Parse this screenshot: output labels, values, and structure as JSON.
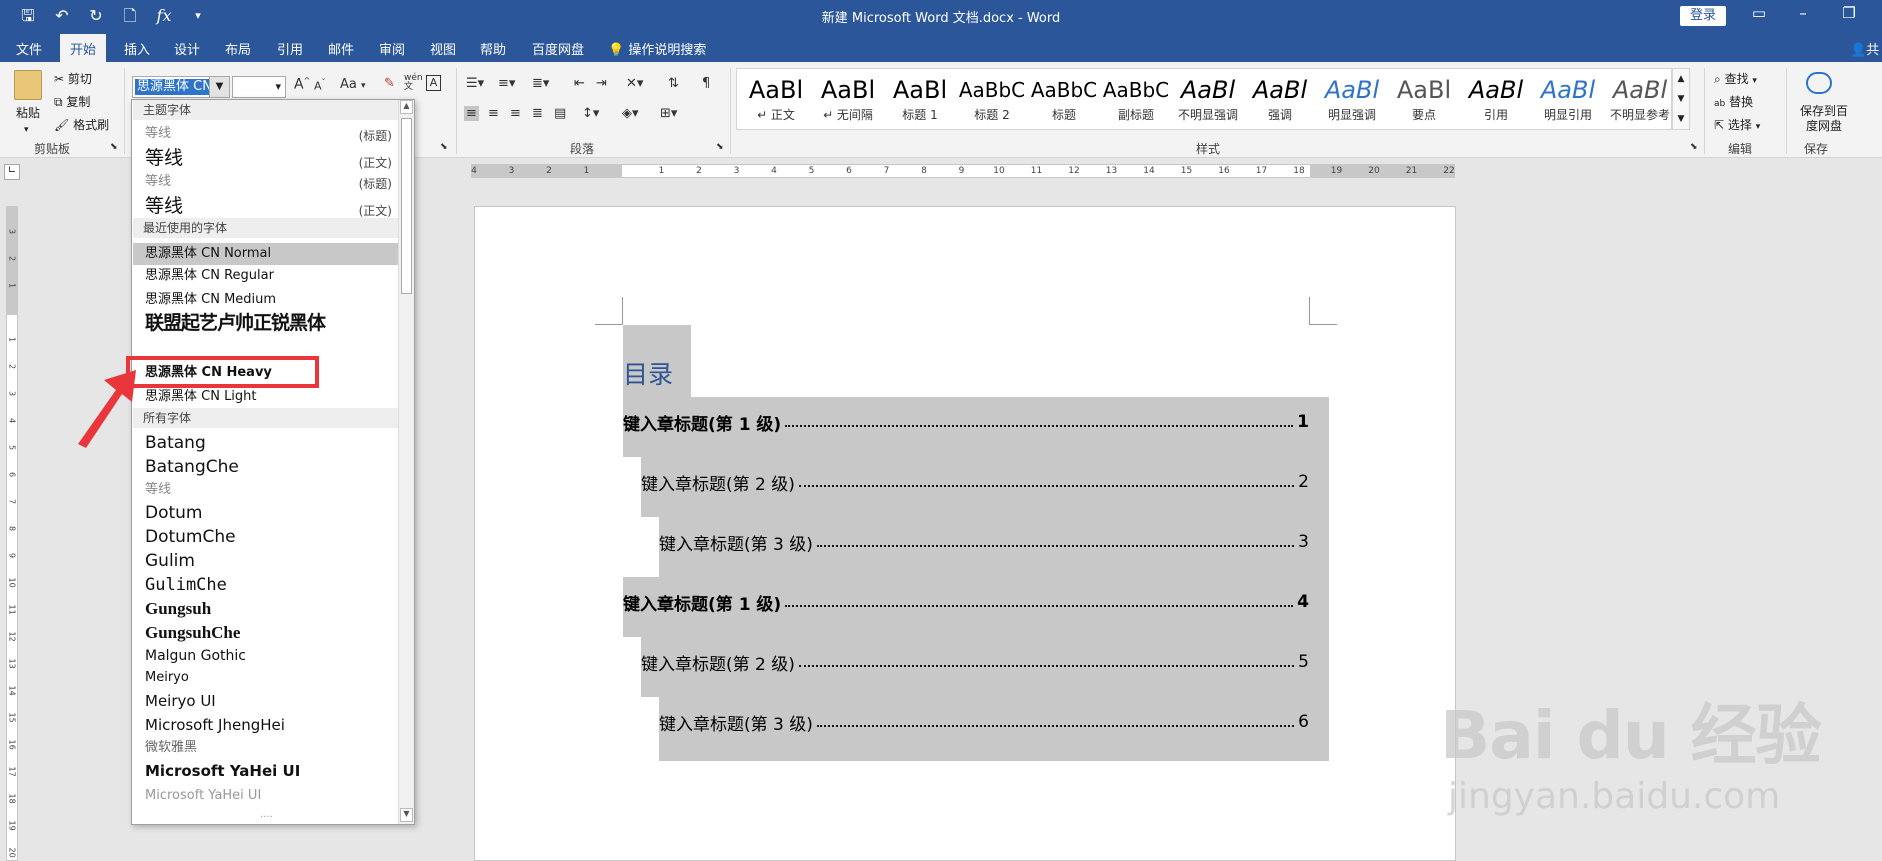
{
  "titlebar": {
    "title": "新建 Microsoft Word 文档.docx - Word",
    "login": "登录",
    "qat_fx": "fx"
  },
  "tabs": [
    "文件",
    "开始",
    "插入",
    "设计",
    "布局",
    "引用",
    "邮件",
    "审阅",
    "视图",
    "帮助",
    "百度网盘"
  ],
  "active_tab": "开始",
  "tell_me": "操作说明搜索",
  "share": "共",
  "ribbon": {
    "clipboard": {
      "paste": "粘贴",
      "cut": "剪切",
      "copy": "复制",
      "format_painter": "格式刷",
      "group": "剪贴板"
    },
    "font": {
      "name_value": "思源黑体 CN",
      "grow": "A",
      "shrink": "A",
      "case": "Aa"
    },
    "paragraph": {
      "group": "段落"
    },
    "styles": {
      "group": "样式",
      "items": [
        {
          "sample": "AaBl",
          "name": "↵ 正文"
        },
        {
          "sample": "AaBl",
          "name": "↵ 无间隔"
        },
        {
          "sample": "AaBl",
          "name": "标题 1"
        },
        {
          "sample": "AaBbC",
          "name": "标题 2"
        },
        {
          "sample": "AaBbC",
          "name": "标题"
        },
        {
          "sample": "AaBbC",
          "name": "副标题"
        },
        {
          "sample": "AaBl",
          "name": "不明显强调"
        },
        {
          "sample": "AaBl",
          "name": "强调"
        },
        {
          "sample": "AaBl",
          "name": "明显强调"
        },
        {
          "sample": "AaBl",
          "name": "要点"
        },
        {
          "sample": "AaBl",
          "name": "引用"
        },
        {
          "sample": "AaBl",
          "name": "明显引用"
        },
        {
          "sample": "AaBl",
          "name": "不明显参考"
        }
      ]
    },
    "editing": {
      "find": "查找",
      "replace": "替换",
      "select": "选择",
      "group": "编辑"
    },
    "save": {
      "label": "保存到百度网盘",
      "group": "保存"
    }
  },
  "ruler_numbers": [
    "4",
    "3",
    "2",
    "1",
    "",
    "1",
    "2",
    "3",
    "4",
    "5",
    "6",
    "7",
    "8",
    "9",
    "10",
    "11",
    "12",
    "13",
    "14",
    "15",
    "16",
    "17",
    "18",
    "19",
    "20",
    "21",
    "22"
  ],
  "vruler_numbers": [
    "3",
    "2",
    "1",
    "",
    "1",
    "2",
    "3",
    "4",
    "5",
    "6",
    "7",
    "8",
    "9",
    "10",
    "11",
    "12",
    "13",
    "14",
    "15",
    "16",
    "17",
    "18",
    "19",
    "20"
  ],
  "font_dropdown": {
    "theme_header": "主题字体",
    "theme_fonts": [
      {
        "name": "等线",
        "tag": "(标题)"
      },
      {
        "name": "等线",
        "tag": "(正文)"
      },
      {
        "name": "等线",
        "tag": "(标题)"
      },
      {
        "name": "等线",
        "tag": "(正文)"
      }
    ],
    "recent_header": "最近使用的字体",
    "recent_fonts": [
      "思源黑体 CN Normal",
      "思源黑体 CN Regular",
      "思源黑体 CN Medium",
      "联盟起艺卢帅正锐黑体",
      "",
      "思源黑体 CN Heavy",
      "思源黑体 CN Light"
    ],
    "all_header": "所有字体",
    "all_fonts": [
      "Batang",
      "BatangChe",
      "等线",
      "Dotum",
      "DotumChe",
      "Gulim",
      "GulimChe",
      "Gungsuh",
      "GungsuhChe",
      "Malgun Gothic",
      "Meiryo",
      "Meiryo UI",
      "Microsoft JhengHei",
      "微软雅黑",
      "Microsoft YaHei UI",
      "Microsoft YaHei UI"
    ],
    "highlighted": "思源黑体 CN Heavy"
  },
  "document": {
    "toc_title": "目录",
    "toc_entries": [
      {
        "text": "键入章标题(第 1 级)",
        "page": "1",
        "level": 1
      },
      {
        "text": "键入章标题(第 2 级)",
        "page": "2",
        "level": 2
      },
      {
        "text": "键入章标题(第 3 级)",
        "page": "3",
        "level": 3
      },
      {
        "text": "键入章标题(第 1 级)",
        "page": "4",
        "level": 1
      },
      {
        "text": "键入章标题(第 2 级)",
        "page": "5",
        "level": 2
      },
      {
        "text": "键入章标题(第 3 级)",
        "page": "6",
        "level": 3
      }
    ]
  },
  "watermark": {
    "logo": "Bai du 经验",
    "sub": "jingyan.baidu.com"
  },
  "colors": {
    "word_blue": "#2b579a",
    "highlight_red": "#e8363a",
    "toc_heading": "#2f5597",
    "field_shading": "#c8c8c8"
  }
}
